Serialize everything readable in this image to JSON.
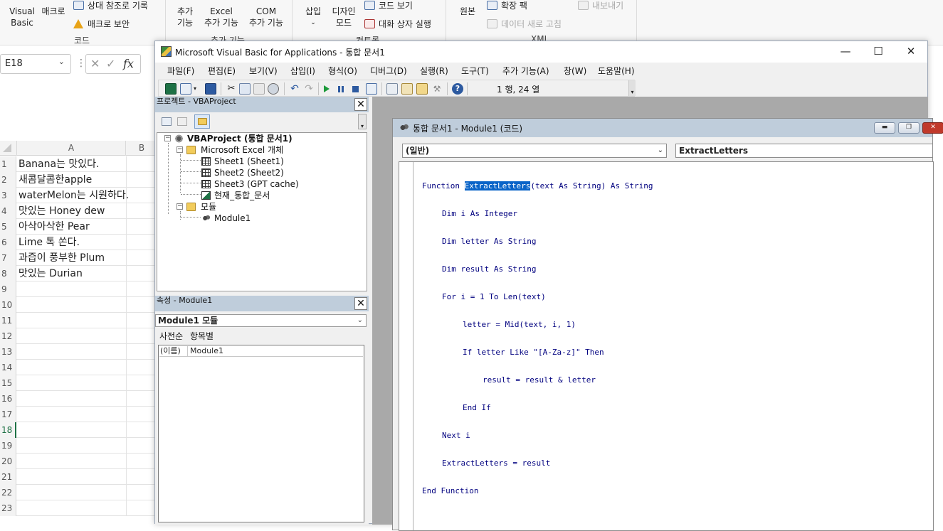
{
  "excel": {
    "ribbon": {
      "visual_basic": [
        "Visual",
        "Basic"
      ],
      "macro": "매크로",
      "relative_ref": "상대 참조로 기록",
      "macro_security": "매크로 보안",
      "code_group": "코드",
      "addins": [
        "추가",
        "기능"
      ],
      "excel_addins": [
        "Excel",
        "추가 기능"
      ],
      "com_addins": [
        "COM",
        "추가 기능"
      ],
      "addins_group": "추가 기능",
      "insert": "삽입",
      "design_mode": [
        "디자인",
        "모드"
      ],
      "view_code": "코드 보기",
      "run_dialog": "대화 상자 실행",
      "controls_group": "컨트롤",
      "source": "원본",
      "expansion_pack": "확장 팩",
      "refresh_data": "데이터 새로 고침",
      "export": "내보내기",
      "xml_group": "XML"
    },
    "name_box": "E18",
    "formula_icons": {
      "cancel": "✕",
      "enter": "✓",
      "fx": "fx"
    },
    "columns": [
      "A",
      "B"
    ],
    "rows": [
      {
        "num": "1",
        "a": "Banana는 맛있다."
      },
      {
        "num": "2",
        "a": "새콤달콤한apple"
      },
      {
        "num": "3",
        "a": "waterMelon는 시원하다."
      },
      {
        "num": "4",
        "a": "맛있는 Honey dew"
      },
      {
        "num": "5",
        "a": "아삭아삭한 Pear"
      },
      {
        "num": "6",
        "a": "Lime 톡 쏜다."
      },
      {
        "num": "7",
        "a": "과즙이 풍부한 Plum"
      },
      {
        "num": "8",
        "a": "맛있는 Durian"
      },
      {
        "num": "9",
        "a": ""
      },
      {
        "num": "10",
        "a": ""
      },
      {
        "num": "11",
        "a": ""
      },
      {
        "num": "12",
        "a": ""
      },
      {
        "num": "13",
        "a": ""
      },
      {
        "num": "14",
        "a": ""
      },
      {
        "num": "15",
        "a": ""
      },
      {
        "num": "16",
        "a": ""
      },
      {
        "num": "17",
        "a": ""
      },
      {
        "num": "18",
        "a": ""
      },
      {
        "num": "19",
        "a": ""
      },
      {
        "num": "20",
        "a": ""
      },
      {
        "num": "21",
        "a": ""
      },
      {
        "num": "22",
        "a": ""
      },
      {
        "num": "23",
        "a": ""
      }
    ],
    "selected_row": "18"
  },
  "vbe": {
    "title": "Microsoft Visual Basic for Applications - 통합 문서1",
    "window_buttons": {
      "minimize": "—",
      "maximize": "☐",
      "close": "✕"
    },
    "menus": [
      "파일(F)",
      "편집(E)",
      "보기(V)",
      "삽입(I)",
      "형식(O)",
      "디버그(D)",
      "실행(R)",
      "도구(T)",
      "추가 기능(A)",
      "창(W)",
      "도움말(H)"
    ],
    "cursor_pos": "1 행, 24 열",
    "project": {
      "title": "프로젝트 - VBAProject",
      "root": "VBAProject (통합 문서1)",
      "excel_objects": "Microsoft Excel 개체",
      "sheets": [
        "Sheet1 (Sheet1)",
        "Sheet2 (Sheet2)",
        "Sheet3 (GPT cache)",
        "현재_통합_문서"
      ],
      "modules_folder": "모듈",
      "module": "Module1"
    },
    "properties": {
      "title": "속성 - Module1",
      "combo": "Module1 모듈",
      "tabs": [
        "사전순",
        "항목별"
      ],
      "row_key": "(이름)",
      "row_value": "Module1"
    },
    "code_window": {
      "title": "통합 문서1 - Module1 (코드)",
      "object_combo": "(일반)",
      "proc_combo": "ExtractLetters",
      "code": {
        "l1_pre": "Function ",
        "l1_sel": "ExtractLetters",
        "l1_post": "(text As String) As String",
        "l2": "Dim i As Integer",
        "l3": "Dim letter As String",
        "l4": "Dim result As String",
        "l5": "For i = 1 To Len(text)",
        "l6": "letter = Mid(text, i, 1)",
        "l7": "If letter Like \"[A-Za-z]\" Then",
        "l8": "result = result & letter",
        "l9": "End If",
        "l10": "Next i",
        "l11": "ExtractLetters = result",
        "l12": "End Function"
      }
    }
  }
}
